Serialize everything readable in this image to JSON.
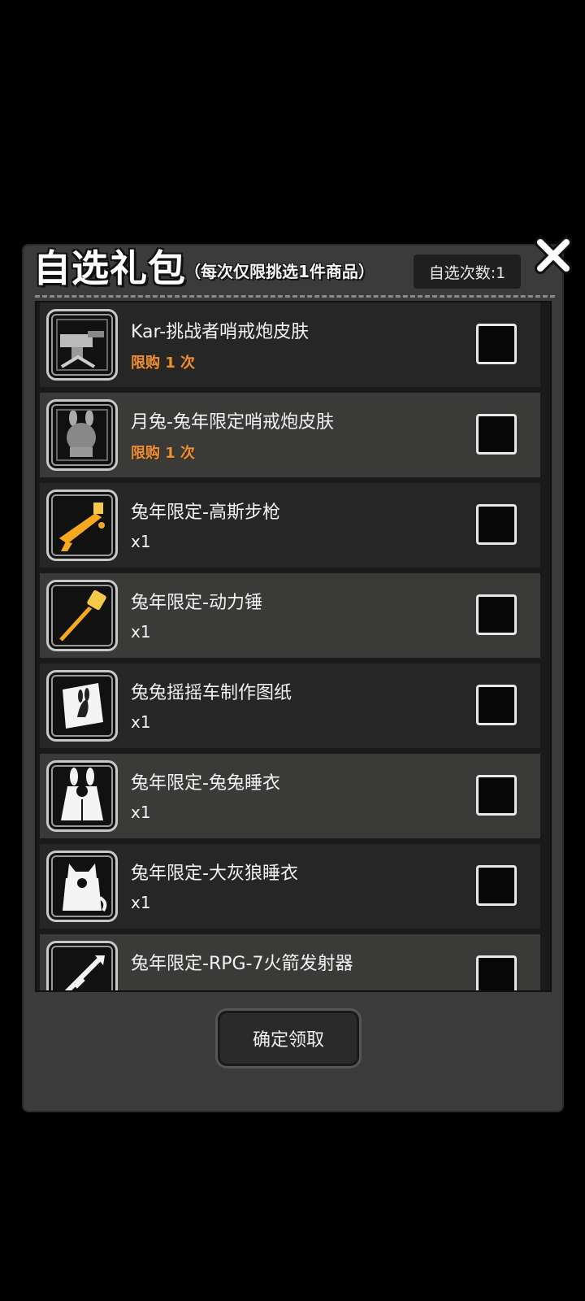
{
  "dialog": {
    "title": "自选礼包",
    "subtitle": "（每次仅限挑选1件商品）",
    "count_label": "自选次数:1",
    "confirm_label": "确定领取"
  },
  "items": [
    {
      "name": "Kar-挑战者哨戒炮皮肤",
      "sub": "限购 1 次",
      "icon": "sentry-gun-skin-icon",
      "checked": false
    },
    {
      "name": "月兔-兔年限定哨戒炮皮肤",
      "sub": "限购 1 次",
      "icon": "rabbit-sentry-skin-icon",
      "checked": false
    },
    {
      "name": "兔年限定-高斯步枪",
      "sub": "x1",
      "icon": "gauss-rifle-icon",
      "checked": false
    },
    {
      "name": "兔年限定-动力锤",
      "sub": "x1",
      "icon": "power-hammer-icon",
      "checked": false
    },
    {
      "name": "兔兔摇摇车制作图纸",
      "sub": "x1",
      "icon": "blueprint-icon",
      "checked": false
    },
    {
      "name": "兔年限定-兔兔睡衣",
      "sub": "x1",
      "icon": "bunny-pajamas-icon",
      "checked": false
    },
    {
      "name": "兔年限定-大灰狼睡衣",
      "sub": "x1",
      "icon": "wolf-pajamas-icon",
      "checked": false
    },
    {
      "name": "兔年限定-RPG-7火箭发射器",
      "sub": "",
      "icon": "rpg-launcher-icon",
      "checked": false
    }
  ],
  "colors": {
    "limit_text": "#e6923a",
    "weapon_gold": "#f5a91f"
  }
}
